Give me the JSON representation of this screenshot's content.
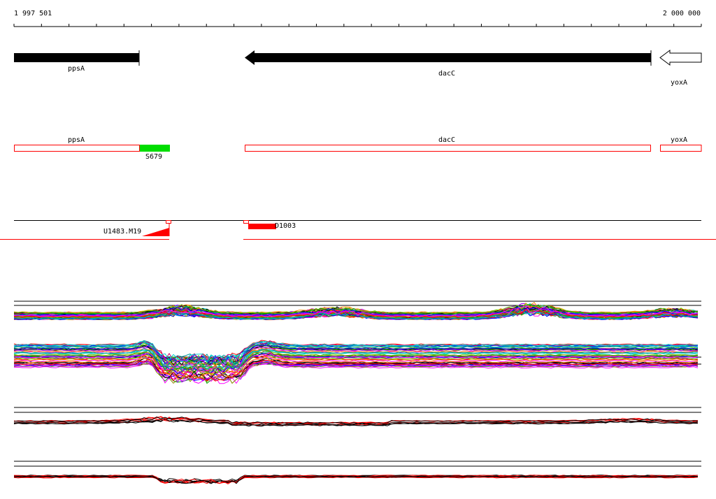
{
  "ruler": {
    "start_label": "1 997 501",
    "end_label": "2 000 000"
  },
  "genes": [
    {
      "name": "ppsA",
      "strand": "forward",
      "style": "filled"
    },
    {
      "name": "dacC",
      "strand": "reverse",
      "style": "filled"
    },
    {
      "name": "yoxA",
      "strand": "reverse",
      "style": "outline"
    }
  ],
  "features": [
    {
      "name": "ppsA",
      "color": "#ff0000"
    },
    {
      "name": "dacC",
      "color": "#ff0000"
    },
    {
      "name": "yoxA",
      "color": "#ff0000"
    },
    {
      "name": "S679",
      "color": "#00dd00"
    }
  ],
  "probes": [
    {
      "name": "U1483.M19",
      "color": "#ff0000"
    },
    {
      "name": "D1003",
      "color": "#ff0000"
    }
  ],
  "colors": {
    "gene_fill": "#000000",
    "feature_outline": "#ff0000",
    "feature_highlight": "#00dd00",
    "separator": "#ff0000",
    "trace_palette": [
      "#ff0000",
      "#00aa00",
      "#0000ff",
      "#ff00ff",
      "#00cccc",
      "#888800",
      "#aa00ff",
      "#ff8800",
      "#009999",
      "#000000",
      "#cc0066",
      "#66cc00"
    ]
  }
}
